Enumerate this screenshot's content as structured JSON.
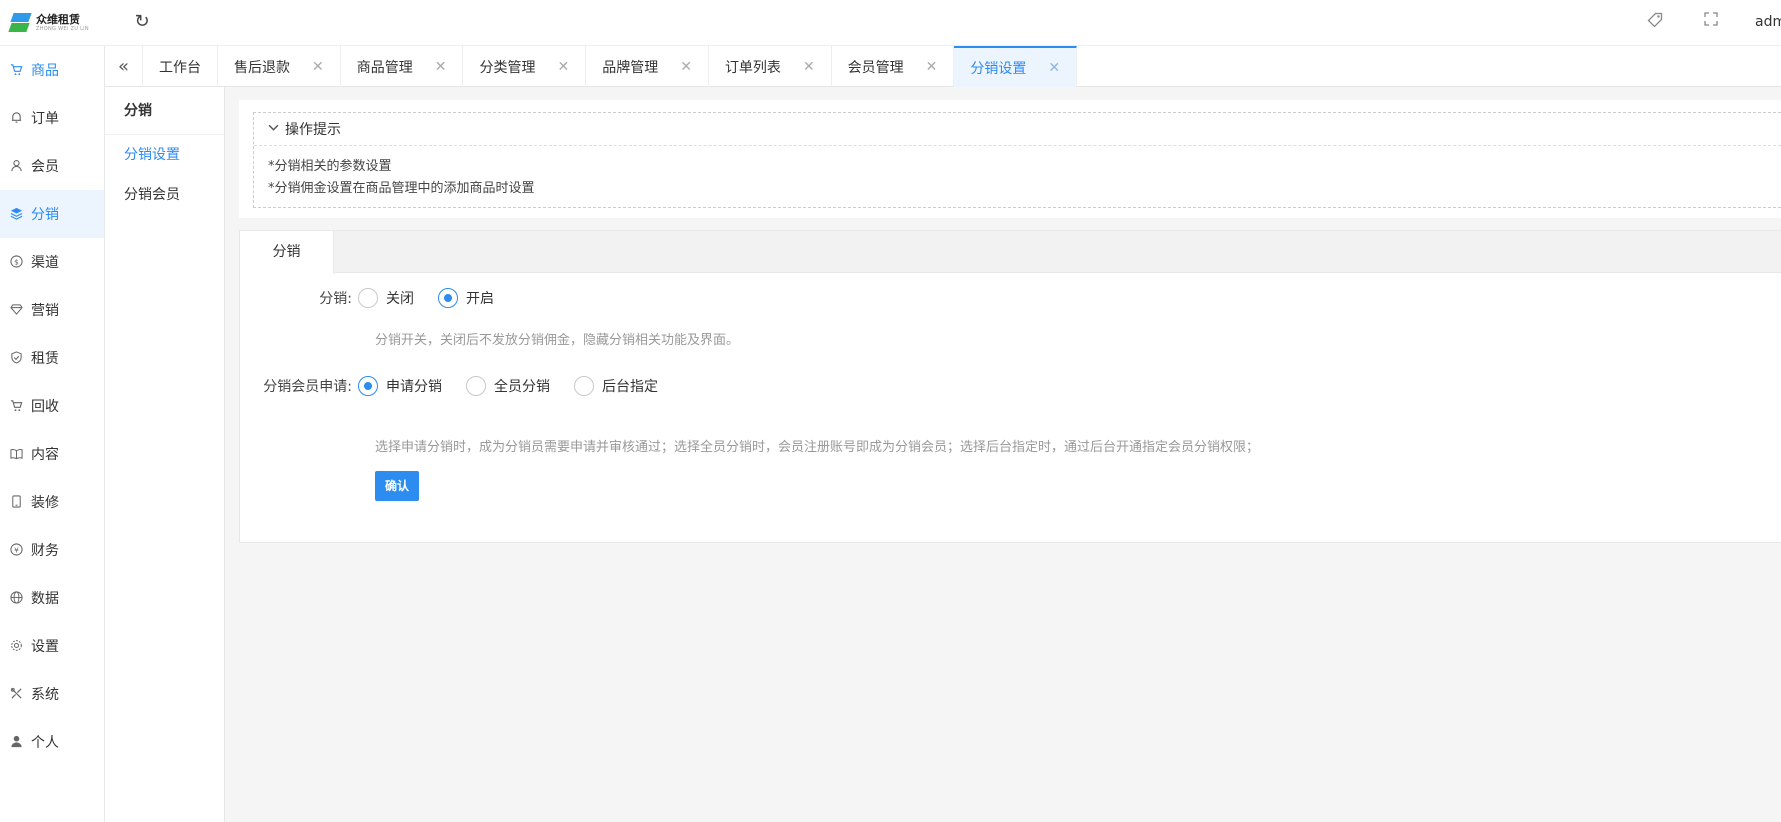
{
  "header": {
    "logo_text": "众维租赁",
    "logo_sub": "ZHONG WEI ZU LIN",
    "user": "admin"
  },
  "sidebar": {
    "items": [
      {
        "label": "商品",
        "icon": "cart-icon"
      },
      {
        "label": "订单",
        "icon": "bell-icon"
      },
      {
        "label": "会员",
        "icon": "user-icon"
      },
      {
        "label": "分销",
        "icon": "layers-icon"
      },
      {
        "label": "渠道",
        "icon": "dollar-icon"
      },
      {
        "label": "营销",
        "icon": "diamond-icon"
      },
      {
        "label": "租赁",
        "icon": "shield-icon"
      },
      {
        "label": "回收",
        "icon": "cart-icon"
      },
      {
        "label": "内容",
        "icon": "book-icon"
      },
      {
        "label": "装修",
        "icon": "tablet-icon"
      },
      {
        "label": "财务",
        "icon": "yen-icon"
      },
      {
        "label": "数据",
        "icon": "globe-icon"
      },
      {
        "label": "设置",
        "icon": "gear-icon"
      },
      {
        "label": "系统",
        "icon": "tools-icon"
      },
      {
        "label": "个人",
        "icon": "person-icon"
      }
    ]
  },
  "tabs": [
    {
      "label": "工作台",
      "closable": false
    },
    {
      "label": "售后退款",
      "closable": true
    },
    {
      "label": "商品管理",
      "closable": true
    },
    {
      "label": "分类管理",
      "closable": true
    },
    {
      "label": "品牌管理",
      "closable": true
    },
    {
      "label": "订单列表",
      "closable": true
    },
    {
      "label": "会员管理",
      "closable": true
    },
    {
      "label": "分销设置",
      "closable": true
    }
  ],
  "subside": {
    "title": "分销",
    "items": [
      "分销设置",
      "分销会员"
    ]
  },
  "tips": {
    "title": "操作提示",
    "lines": [
      "*分销相关的参数设置",
      "*分销佣金设置在商品管理中的添加商品时设置"
    ]
  },
  "card": {
    "tab": "分销",
    "distribution": {
      "label": "分销:",
      "options": [
        "关闭",
        "开启"
      ],
      "selected": "开启",
      "hint": "分销开关，关闭后不发放分销佣金，隐藏分销相关功能及界面。"
    },
    "apply": {
      "label": "分销会员申请:",
      "options": [
        "申请分销",
        "全员分销",
        "后台指定"
      ],
      "selected": "申请分销",
      "hint": "选择申请分销时，成为分销员需要申请并审核通过；选择全员分销时，会员注册账号即成为分销会员；选择后台指定时，通过后台开通指定会员分销权限；"
    },
    "confirm_label": "确认"
  },
  "colors": {
    "accent": "#2d8cf0",
    "active_bg": "#ecf4fd"
  }
}
